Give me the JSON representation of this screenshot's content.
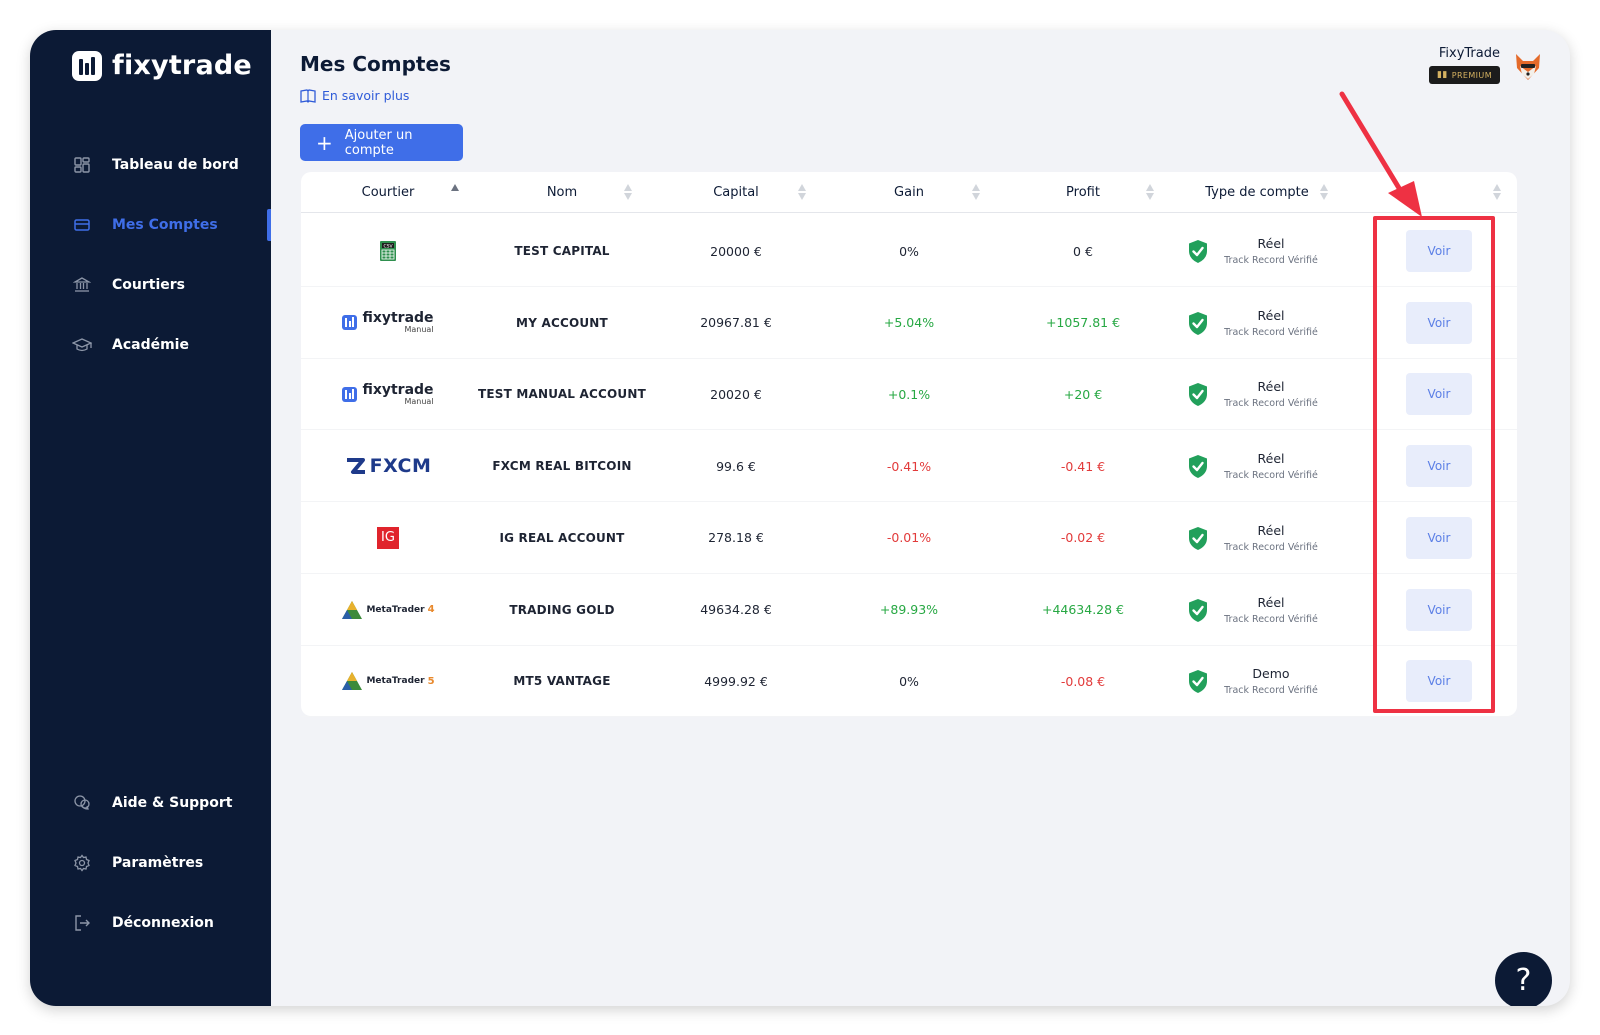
{
  "app": {
    "logo_text": "fixytrade"
  },
  "sidebar": {
    "items": [
      {
        "label": "Tableau de bord",
        "icon": "dashboard-icon"
      },
      {
        "label": "Mes Comptes",
        "icon": "accounts-icon",
        "active": true
      },
      {
        "label": "Courtiers",
        "icon": "bank-icon"
      },
      {
        "label": "Académie",
        "icon": "graduation-cap-icon"
      }
    ],
    "bottom_items": [
      {
        "label": "Aide & Support",
        "icon": "support-icon"
      },
      {
        "label": "Paramètres",
        "icon": "gear-icon"
      },
      {
        "label": "Déconnexion",
        "icon": "logout-icon"
      }
    ]
  },
  "header": {
    "title": "Mes Comptes",
    "learn_more": "En savoir plus",
    "add_button": "Ajouter un compte",
    "user_name": "FixyTrade",
    "badge": "PREMIUM"
  },
  "table": {
    "columns": [
      "Courtier",
      "Nom",
      "Capital",
      "Gain",
      "Profit",
      "Type de compte"
    ],
    "action_label": "Voir",
    "rows": [
      {
        "broker": "csv",
        "name": "TEST CAPITAL",
        "capital": "20000 €",
        "gain": "0%",
        "gain_sign": "zero",
        "profit": "0 €",
        "profit_sign": "zero",
        "type": "Réel",
        "type_sub": "Track Record Vérifié"
      },
      {
        "broker": "fixytrade",
        "name": "MY ACCOUNT",
        "capital": "20967.81 €",
        "gain": "+5.04%",
        "gain_sign": "pos",
        "profit": "+1057.81 €",
        "profit_sign": "pos",
        "type": "Réel",
        "type_sub": "Track Record Vérifié"
      },
      {
        "broker": "fixytrade",
        "name": "TEST MANUAL ACCOUNT",
        "capital": "20020 €",
        "gain": "+0.1%",
        "gain_sign": "pos",
        "profit": "+20 €",
        "profit_sign": "pos",
        "type": "Réel",
        "type_sub": "Track Record Vérifié"
      },
      {
        "broker": "fxcm",
        "name": "FXCM REAL BITCOIN",
        "capital": "99.6 €",
        "gain": "-0.41%",
        "gain_sign": "neg",
        "profit": "-0.41 €",
        "profit_sign": "neg",
        "type": "Réel",
        "type_sub": "Track Record Vérifié"
      },
      {
        "broker": "ig",
        "name": "IG REAL ACCOUNT",
        "capital": "278.18 €",
        "gain": "-0.01%",
        "gain_sign": "neg",
        "profit": "-0.02 €",
        "profit_sign": "neg",
        "type": "Réel",
        "type_sub": "Track Record Vérifié"
      },
      {
        "broker": "mt4",
        "name": "TRADING GOLD",
        "capital": "49634.28 €",
        "gain": "+89.93%",
        "gain_sign": "pos",
        "profit": "+44634.28 €",
        "profit_sign": "pos",
        "type": "Réel",
        "type_sub": "Track Record Vérifié"
      },
      {
        "broker": "mt5",
        "name": "MT5 VANTAGE",
        "capital": "4999.92 €",
        "gain": "0%",
        "gain_sign": "zero",
        "profit": "-0.08 €",
        "profit_sign": "neg",
        "type": "Demo",
        "type_sub": "Track Record Vérifié"
      }
    ]
  },
  "brokers": {
    "csv": {
      "label": "CSV"
    },
    "fixytrade": {
      "name": "fixytrade",
      "sub": "Manual"
    },
    "fxcm": {
      "name": "FXCM"
    },
    "ig": {
      "name": "IG"
    },
    "mt4": {
      "name": "MetaTrader",
      "version": "4"
    },
    "mt5": {
      "name": "MetaTrader",
      "version": "5"
    }
  },
  "help": {
    "label": "?"
  },
  "colors": {
    "sidebar": "#0c1a35",
    "accent": "#3f6ee8",
    "positive": "#27a843",
    "negative": "#e23b3b",
    "highlight": "#ee3143"
  }
}
